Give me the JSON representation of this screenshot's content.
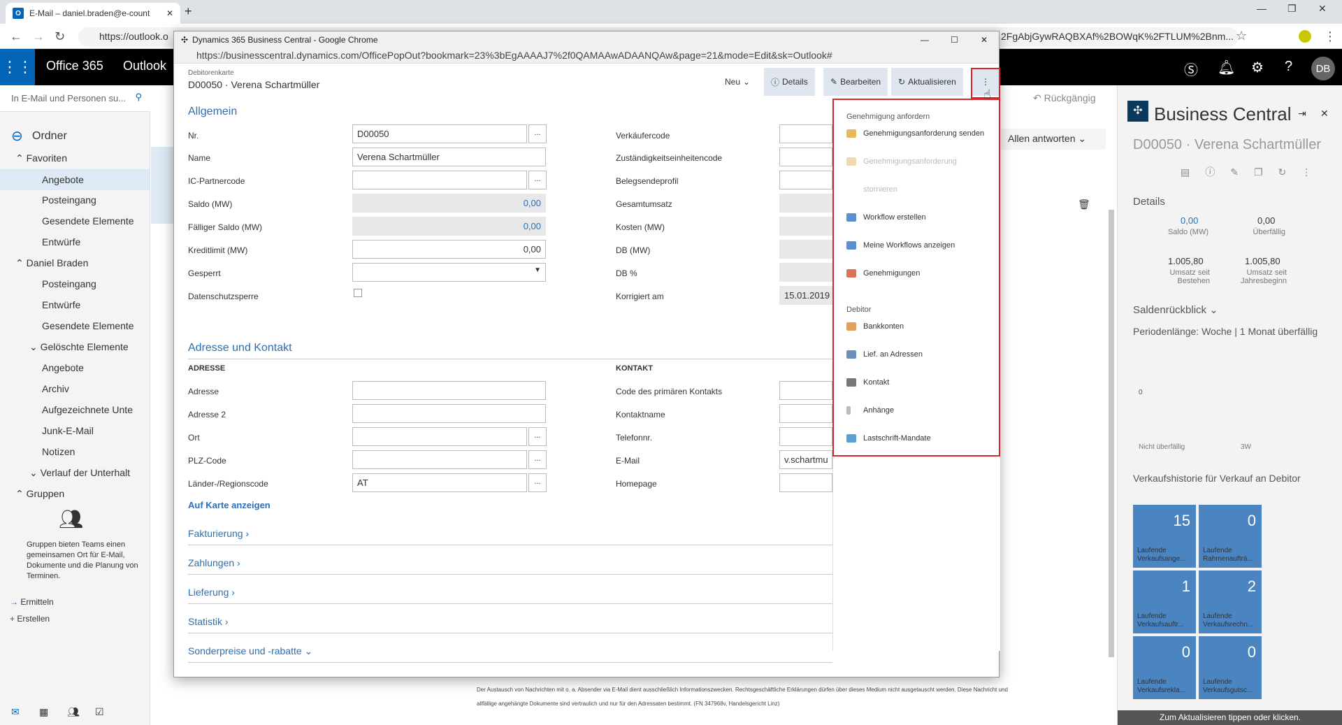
{
  "browser": {
    "tab_title": "E-Mail – daniel.braden@e-count",
    "url": "https://outlook.o",
    "url_right": "2FgAbjGywRAQBXAf%2BOWqK%2FTLUM%2Bnm..."
  },
  "o365": {
    "brand": "Office 365",
    "app": "Outlook",
    "avatar": "DB"
  },
  "outlook": {
    "search_placeholder": "In E-Mail und Personen su...",
    "folders_title": "Ordner",
    "favorites": "Favoriten",
    "fav_items": [
      "Angebote",
      "Posteingang",
      "Gesendete Elemente",
      "Entwürfe"
    ],
    "account": "Daniel Braden",
    "acc_items": [
      "Posteingang",
      "Entwürfe",
      "Gesendete Elemente",
      "Gelöschte Elemente",
      "Angebote",
      "Archiv",
      "Aufgezeichnete Unte",
      "Junk-E-Mail",
      "Notizen",
      "Verlauf der Unterhalt"
    ],
    "groups": "Gruppen",
    "groups_text": "Gruppen bieten Teams einen gemeinsamen Ort für E-Mail, Dokumente und die Planung von Terminen.",
    "discover": "Ermitteln",
    "create": "Erstellen",
    "undo": "Rückgängig",
    "reply_all": "Allen antworten",
    "disclaimer1": "Der Austausch von Nachrichten mit o. a. Absender via E-Mail dient ausschließlich Informationszwecken. Rechtsgeschäftliche Erklärungen dürfen über dieses Medium nicht ausgetauscht werden. Diese Nachricht und",
    "disclaimer2": "allfällige angehängte Dokumente sind vertraulich und nur für den Adressaten bestimmt. (FN 347968v, Handelsgericht Linz)"
  },
  "bc": {
    "title": "Business Central",
    "record": "D00050 · Verena Schartmüller",
    "details": "Details",
    "balance": "0,00",
    "balance_lbl": "Saldo (MW)",
    "overdue": "0,00",
    "overdue_lbl": "Überfällig",
    "sales1": "1.005,80",
    "sales1_lbl": "Umsatz seit Bestehen",
    "sales2": "1.005,80",
    "sales2_lbl": "Umsatz seit Jahresbeginn",
    "backlog": "Saldenrückblick",
    "period": "Periodenlänge: Woche | 1 Monat überfällig",
    "zero": "0",
    "xlbl1": "Nicht überfällig",
    "xlbl2": "3W",
    "history": "Verkaufshistorie für Verkauf an Debitor",
    "tiles": [
      {
        "num": "15",
        "label": "Laufende Verkaufsange..."
      },
      {
        "num": "0",
        "label": "Laufende Rahmenaufträ..."
      },
      {
        "num": "1",
        "label": "Laufende Verkaufsauftr..."
      },
      {
        "num": "2",
        "label": "Laufende Verkaufsrechn..."
      },
      {
        "num": "0",
        "label": "Laufende Verkaufsrekla..."
      },
      {
        "num": "0",
        "label": "Laufende Verkaufsgutsc..."
      }
    ],
    "footer": "Zum Aktualisieren tippen oder klicken."
  },
  "popup": {
    "window_title": "Dynamics 365 Business Central - Google Chrome",
    "url": "https://businesscentral.dynamics.com/OfficePopOut?bookmark=23%3bEgAAAAJ7%2f0QAMAAwADAANQAw&page=21&mode=Edit&sk=Outlook#",
    "breadcrumb": "Debitorenkarte",
    "record": "D00050 · Verena Schartmüller",
    "cmd": {
      "new": "Neu",
      "details": "Details",
      "edit": "Bearbeiten",
      "refresh": "Aktualisieren"
    },
    "general": "Allgemein",
    "fields_left": [
      {
        "label": "Nr.",
        "value": "D00050"
      },
      {
        "label": "Name",
        "value": "Verena Schartmüller"
      },
      {
        "label": "IC-Partnercode",
        "value": ""
      },
      {
        "label": "Saldo (MW)",
        "value": "0,00"
      },
      {
        "label": "Fälliger Saldo (MW)",
        "value": "0,00"
      },
      {
        "label": "Kreditlimit (MW)",
        "value": "0,00"
      },
      {
        "label": "Gesperrt",
        "value": ""
      },
      {
        "label": "Datenschutzsperre",
        "value": ""
      }
    ],
    "fields_right": [
      "Verkäufercode",
      "Zuständigkeitseinheitencode",
      "Belegsendeprofil",
      "Gesamtumsatz",
      "Kosten (MW)",
      "DB (MW)",
      "DB %",
      "Korrigiert am"
    ],
    "corrected_on": "15.01.2019",
    "address_section": "Adresse und Kontakt",
    "address_head": "ADRESSE",
    "contact_head": "KONTAKT",
    "addr_fields": [
      {
        "label": "Adresse",
        "value": ""
      },
      {
        "label": "Adresse 2",
        "value": ""
      },
      {
        "label": "Ort",
        "value": ""
      },
      {
        "label": "PLZ-Code",
        "value": ""
      },
      {
        "label": "Länder-/Regionscode",
        "value": "AT"
      }
    ],
    "contact_fields": [
      "Code des primären Kontakts",
      "Kontaktname",
      "Telefonnr.",
      "E-Mail",
      "Homepage"
    ],
    "email_value": "v.schartmu",
    "map_link": "Auf Karte anzeigen",
    "sections": [
      "Fakturierung",
      "Zahlungen",
      "Lieferung",
      "Statistik",
      "Sonderpreise und -rabatte"
    ]
  },
  "menu": {
    "head1": "Genehmigung anfordern",
    "items1": [
      "Genehmigungsanforderung senden",
      "Genehmigungsanforderung",
      "stornieren",
      "Workflow erstellen",
      "Meine Workflows anzeigen",
      "Genehmigungen"
    ],
    "head2": "Debitor",
    "items2": [
      "Bankkonten",
      "Lief. an Adressen",
      "Kontakt",
      "Anhänge",
      "Lastschrift-Mandate"
    ]
  },
  "colors": {
    "accent": "#2b6fb5",
    "tile": "#4a85c2",
    "highlight": "#d9252c"
  }
}
